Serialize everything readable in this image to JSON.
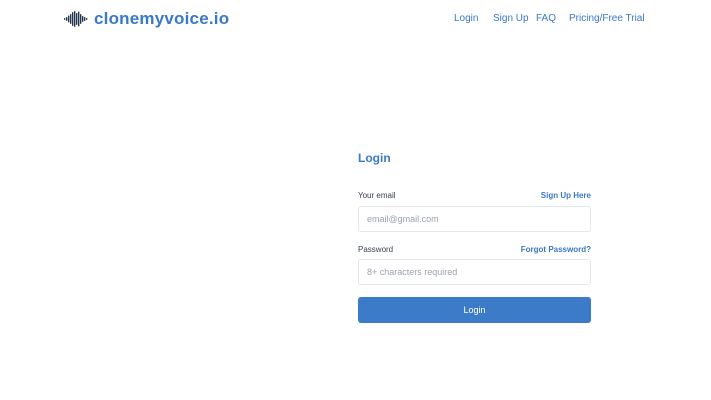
{
  "brand": {
    "name": "clonemyvoice.io",
    "icon": "soundwave-logo-icon",
    "color": "#3a78c9"
  },
  "nav": {
    "items": [
      {
        "label": "Login"
      },
      {
        "label": "Sign Up"
      },
      {
        "label": "FAQ"
      },
      {
        "label": "Pricing/Free Trial"
      }
    ]
  },
  "login_form": {
    "title": "Login",
    "email_label": "Your email",
    "email_placeholder": "email@gmail.com",
    "email_value": "",
    "signup_link": "Sign Up Here",
    "password_label": "Password",
    "password_placeholder": "8+ characters required",
    "password_value": "",
    "forgot_link": "Forgot Password?",
    "submit_label": "Login"
  },
  "colors": {
    "accent": "#3a78c9",
    "button": "#3b7bc8",
    "input_border": "#e5e7eb",
    "logo": "#26364d"
  }
}
